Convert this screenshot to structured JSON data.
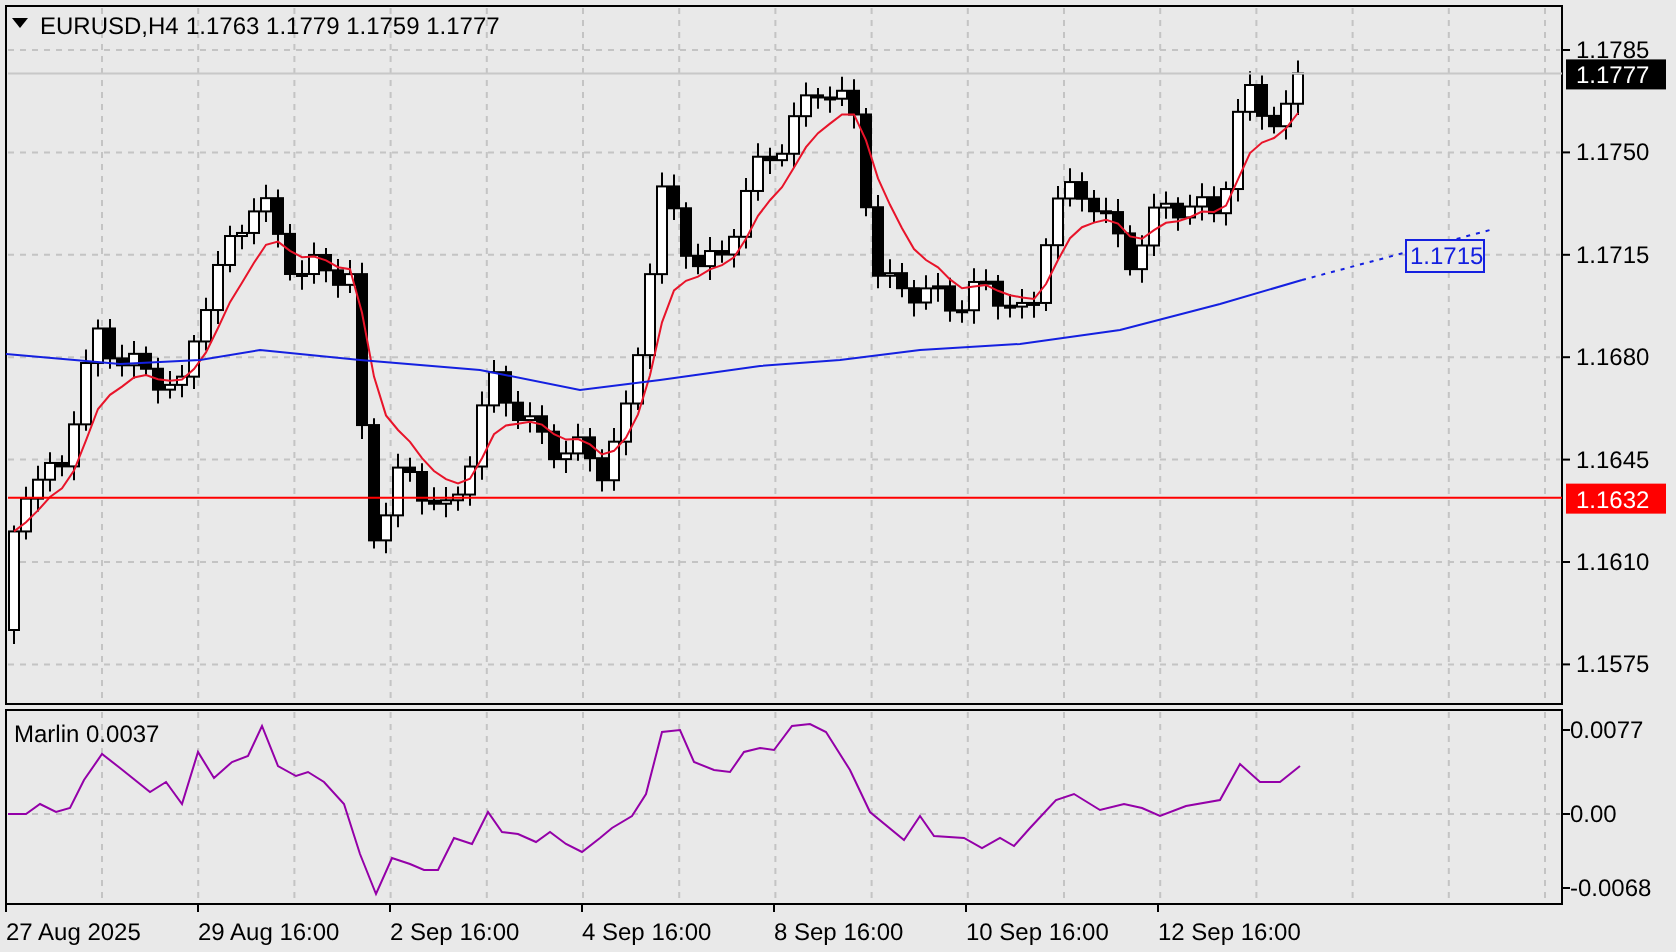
{
  "chart": {
    "symbol": "EURUSD,H4",
    "ohlc": [
      "1.1763",
      "1.1779",
      "1.1759",
      "1.1777"
    ],
    "price_axis": [
      "1.1785",
      "1.1750",
      "1.1715",
      "1.1680",
      "1.1645",
      "1.1610",
      "1.1575"
    ],
    "current_price": "1.1777",
    "level_price": "1.1632",
    "ma_label": "1.1715"
  },
  "indicator": {
    "title": "Marlin 0.0037",
    "axis": [
      "0.0077",
      "0.00",
      "-0.0068"
    ]
  },
  "time_axis": [
    "27 Aug 2025",
    "29 Aug 16:00",
    "2 Sep 16:00",
    "4 Sep 16:00",
    "8 Sep 16:00",
    "10 Sep 16:00",
    "12 Sep 16:00"
  ]
}
